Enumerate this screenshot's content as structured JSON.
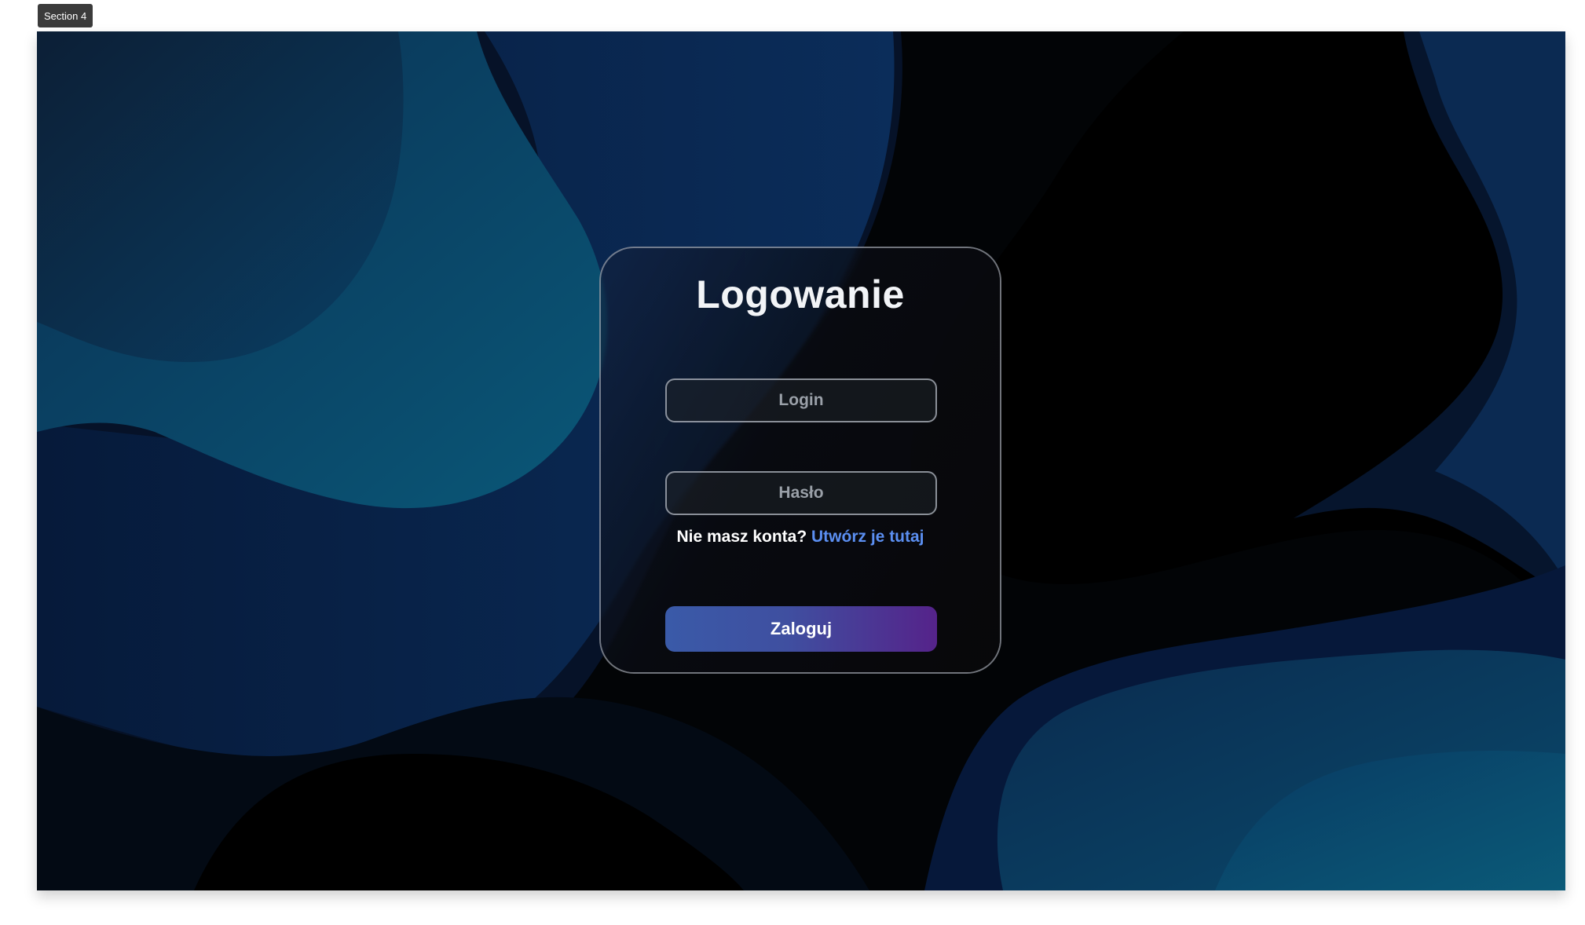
{
  "section_label": "Section 4",
  "login_form": {
    "title": "Logowanie",
    "login_placeholder": "Login",
    "password_placeholder": "Hasło",
    "no_account_text": "Nie masz konta?",
    "signup_link_text": "Utwórz je tutaj",
    "submit_label": "Zaloguj"
  },
  "colors": {
    "link": "#5b8ff2",
    "button_gradient_start": "#3a5aa8",
    "button_gradient_end": "#55238a",
    "background_teal": "#0b5a78",
    "background_navy": "#0b1e3d"
  }
}
